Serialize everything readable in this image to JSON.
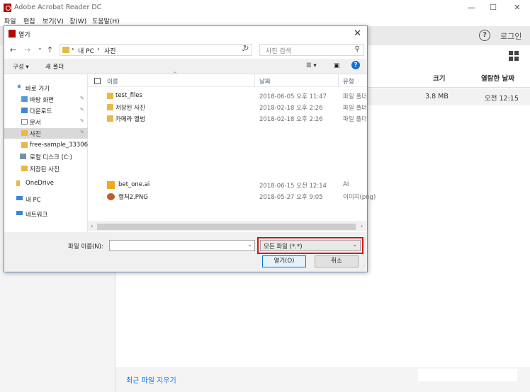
{
  "app": {
    "title": "Adobe Acrobat Reader DC",
    "window_buttons": {
      "minimize": "—",
      "maximize": "☐",
      "close": "✕"
    },
    "menu": [
      "파일",
      "편집",
      "보기(V)",
      "창(W)",
      "도움말(H)"
    ],
    "login": "로그인",
    "help": "?",
    "recent_list": {
      "headers": {
        "size": "크기",
        "opened": "열람한 날짜"
      },
      "row": {
        "size": "3.8 MB",
        "opened": "오전 12:15"
      }
    },
    "clear_recent": "최근 파일 지우기"
  },
  "dialog": {
    "title": "열기",
    "close": "✕",
    "nav": {
      "back": "←",
      "forward": "→",
      "dropdown": "⌄",
      "up": "↑"
    },
    "breadcrumb": [
      "내 PC",
      "사진"
    ],
    "breadcrumb_sep": "›",
    "refresh": "↻",
    "search_placeholder": "사진 검색",
    "toolbar": {
      "organize": "구성 ▾",
      "new_folder": "새 폴더",
      "help": "?"
    },
    "nav_items": [
      {
        "label": "바로 가기",
        "icon": "star-icon",
        "pinned": false,
        "selected": false
      },
      {
        "label": "바탕 화면",
        "icon": "desktop-icon",
        "pinned": true,
        "selected": false
      },
      {
        "label": "다운로드",
        "icon": "download-icon",
        "pinned": true,
        "selected": false
      },
      {
        "label": "문서",
        "icon": "document-icon",
        "pinned": true,
        "selected": false
      },
      {
        "label": "사진",
        "icon": "pictures-icon",
        "pinned": true,
        "selected": true
      },
      {
        "label": "free-sample_33306",
        "icon": "folder-icon",
        "pinned": false,
        "selected": false
      },
      {
        "label": "로컬 디스크 (C:)",
        "icon": "drive-icon",
        "pinned": false,
        "selected": false
      },
      {
        "label": "저장된 사진",
        "icon": "folder-icon",
        "pinned": false,
        "selected": false
      },
      {
        "label": "OneDrive",
        "icon": "onedrive-icon",
        "pinned": false,
        "selected": false
      },
      {
        "label": "내 PC",
        "icon": "computer-icon",
        "pinned": false,
        "selected": false
      },
      {
        "label": "네트워크",
        "icon": "network-icon",
        "pinned": false,
        "selected": false
      }
    ],
    "pin_glyph": "📌",
    "columns": {
      "name": "이름",
      "date": "날짜",
      "type": "유형"
    },
    "files": [
      {
        "name": "test_files",
        "date": "2018-06-05 오후 11:47",
        "type": "파일 폴더",
        "icon": "folder-icon"
      },
      {
        "name": "저장된 사진",
        "date": "2018-02-18 오후 2:26",
        "type": "파일 폴더",
        "icon": "folder-icon"
      },
      {
        "name": "카메라 앨범",
        "date": "2018-02-18 오후 2:26",
        "type": "파일 폴더",
        "icon": "folder-icon"
      },
      {
        "name": "bet_one.ai",
        "date": "2018-06-15 오전 12:14",
        "type": "AI",
        "icon": "illustrator-file-icon"
      },
      {
        "name": "캡처2.PNG",
        "date": "2018-05-27 오후 9:05",
        "type": "이미지(png)",
        "icon": "image-file-icon"
      }
    ],
    "filename_label": "파일 이름(N):",
    "filename_value": "",
    "filter_value": "모든 파일 (*.*)",
    "open_button": "열기(O)",
    "cancel_button": "취소",
    "colors": {
      "highlight": "#e01010",
      "accent": "#0078d7",
      "acrobat_red": "#b30b00"
    }
  }
}
